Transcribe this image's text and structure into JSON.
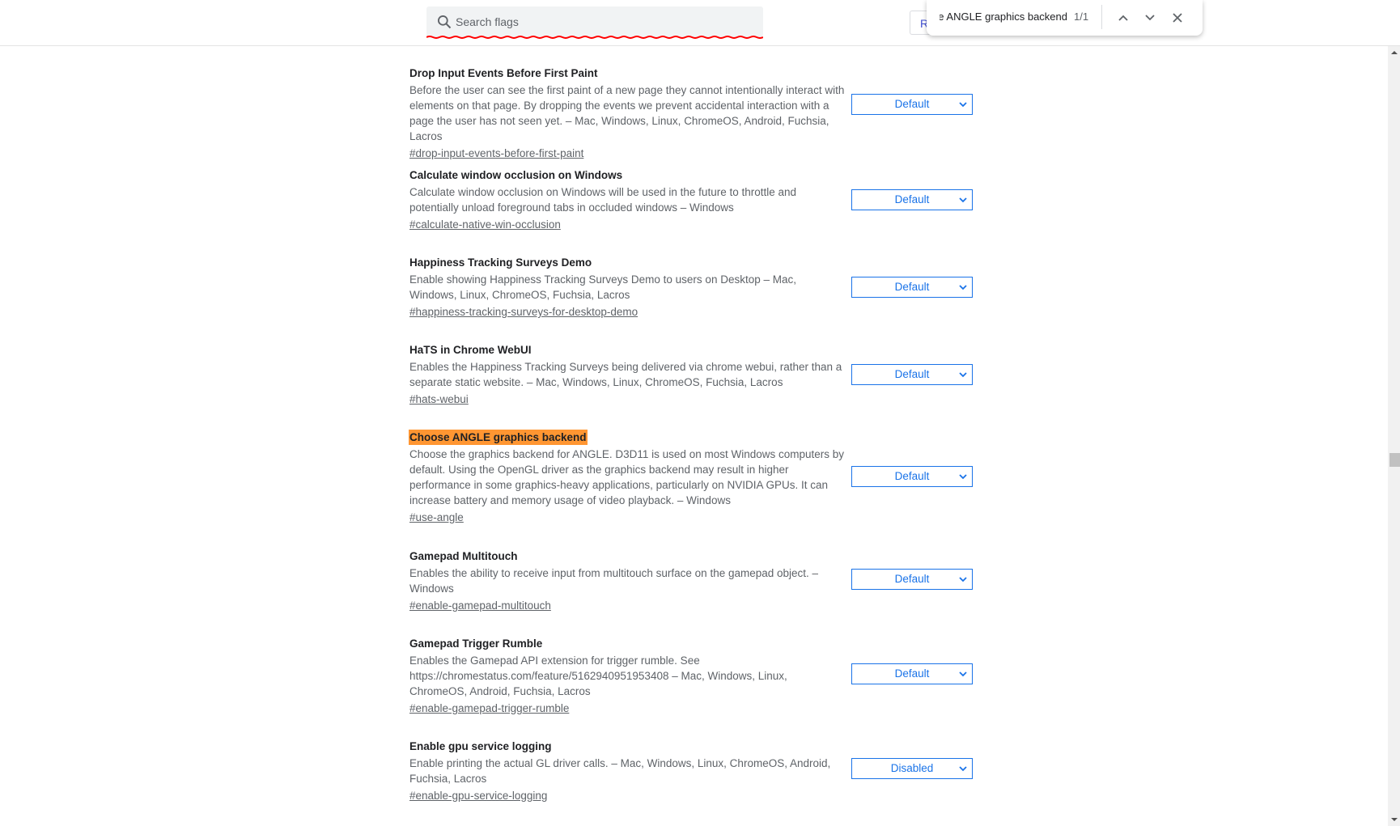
{
  "header": {
    "search": {
      "placeholder": "Search flags",
      "value": "",
      "icon": "search-icon"
    },
    "reset_button_partial": "R"
  },
  "find_bar": {
    "query": "Choose ANGLE graphics backend",
    "count": "1/1",
    "icons": [
      "chevron-up-icon",
      "chevron-down-icon",
      "close-icon"
    ]
  },
  "colors": {
    "highlight": "#ff9632",
    "accent": "#1a73e8",
    "spellcheck": "#ff0000"
  },
  "flags": [
    {
      "title": "Drop Input Events Before First Paint",
      "description": "Before the user can see the first paint of a new page they cannot intentionally interact with elements on that page. By dropping the events we prevent accidental interaction with a page the user has not seen yet. – Mac, Windows, Linux, ChromeOS, Android, Fuchsia, Lacros",
      "link": "#drop-input-events-before-first-paint",
      "value": "Default"
    },
    {
      "title": "Calculate window occlusion on Windows",
      "description": "Calculate window occlusion on Windows will be used in the future to throttle and potentially unload foreground tabs in occluded windows – Windows",
      "link": "#calculate-native-win-occlusion",
      "value": "Default"
    },
    {
      "title": "Happiness Tracking Surveys Demo",
      "description": "Enable showing Happiness Tracking Surveys Demo to users on Desktop – Mac, Windows, Linux, ChromeOS, Fuchsia, Lacros",
      "link": "#happiness-tracking-surveys-for-desktop-demo",
      "value": "Default"
    },
    {
      "title": "HaTS in Chrome WebUI",
      "description": "Enables the Happiness Tracking Surveys being delivered via chrome webui, rather than a separate static website. – Mac, Windows, Linux, ChromeOS, Fuchsia, Lacros",
      "link": "#hats-webui",
      "value": "Default"
    },
    {
      "title": "Choose ANGLE graphics backend",
      "description": "Choose the graphics backend for ANGLE. D3D11 is used on most Windows computers by default. Using the OpenGL driver as the graphics backend may result in higher performance in some graphics-heavy applications, particularly on NVIDIA GPUs. It can increase battery and memory usage of video playback. – Windows",
      "link": "#use-angle",
      "value": "Default",
      "highlighted": true
    },
    {
      "title": "Gamepad Multitouch",
      "description": "Enables the ability to receive input from multitouch surface on the gamepad object. – Windows",
      "link": "#enable-gamepad-multitouch",
      "value": "Default"
    },
    {
      "title": "Gamepad Trigger Rumble",
      "description": "Enables the Gamepad API extension for trigger rumble. See https://chromestatus.com/feature/5162940951953408 – Mac, Windows, Linux, ChromeOS, Android, Fuchsia, Lacros",
      "link": "#enable-gamepad-trigger-rumble",
      "value": "Default"
    },
    {
      "title": "Enable gpu service logging",
      "description": "Enable printing the actual GL driver calls. – Mac, Windows, Linux, ChromeOS, Android, Fuchsia, Lacros",
      "link": "#enable-gpu-service-logging",
      "value": "Disabled"
    }
  ]
}
